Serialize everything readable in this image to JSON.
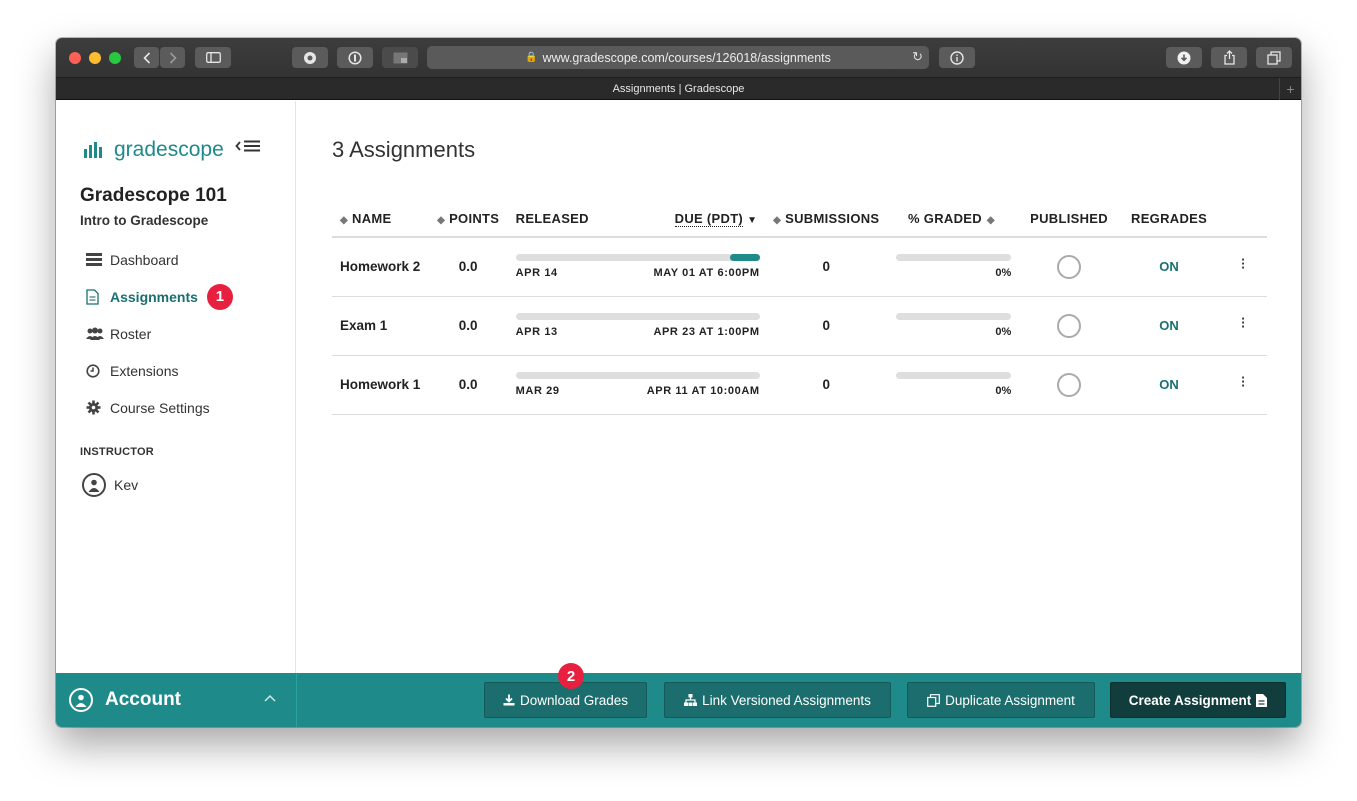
{
  "browser": {
    "url": "www.gradescope.com/courses/126018/assignments",
    "tab_title": "Assignments | Gradescope",
    "new_tab": "+"
  },
  "sidebar": {
    "logo_text": "gradescope",
    "course_title": "Gradescope 101",
    "course_subtitle": "Intro to Gradescope",
    "items": [
      {
        "label": "Dashboard",
        "icon": "dashboard-icon"
      },
      {
        "label": "Assignments",
        "icon": "document-icon",
        "active": true,
        "badge": "1"
      },
      {
        "label": "Roster",
        "icon": "people-icon"
      },
      {
        "label": "Extensions",
        "icon": "clock-icon"
      },
      {
        "label": "Course Settings",
        "icon": "gear-icon"
      }
    ],
    "section_label": "INSTRUCTOR",
    "user_name": "Kev"
  },
  "main": {
    "title": "3 Assignments",
    "columns": {
      "name": "NAME",
      "points": "POINTS",
      "released": "RELEASED",
      "due": "DUE (PDT)",
      "submissions": "SUBMISSIONS",
      "graded": "% GRADED",
      "published": "PUBLISHED",
      "regrades": "REGRADES"
    },
    "rows": [
      {
        "name": "Homework 2",
        "points": "0.0",
        "released": "APR 14",
        "due": "MAY 01 AT 6:00PM",
        "progress": 0.12,
        "submissions": "0",
        "graded": "0%",
        "regrades": "ON"
      },
      {
        "name": "Exam 1",
        "points": "0.0",
        "released": "APR 13",
        "due": "APR 23 AT 1:00PM",
        "progress": 0,
        "submissions": "0",
        "graded": "0%",
        "regrades": "ON"
      },
      {
        "name": "Homework 1",
        "points": "0.0",
        "released": "MAR 29",
        "due": "APR 11 AT 10:00AM",
        "progress": 0,
        "submissions": "0",
        "graded": "0%",
        "regrades": "ON"
      }
    ]
  },
  "footer": {
    "account_label": "Account",
    "badge": "2",
    "buttons": {
      "download": "Download Grades",
      "link": "Link Versioned Assignments",
      "duplicate": "Duplicate Assignment",
      "create": "Create Assignment"
    }
  },
  "colors": {
    "brand": "#1f8a8a",
    "badge": "#e8203f",
    "primary_button": "#123d3d"
  }
}
